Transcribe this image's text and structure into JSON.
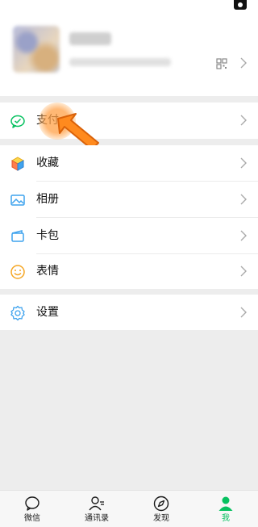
{
  "menu": {
    "pay_label": "支付",
    "favorites_label": "收藏",
    "album_label": "相册",
    "cards_label": "卡包",
    "stickers_label": "表情",
    "settings_label": "设置"
  },
  "tabbar": {
    "chats_label": "微信",
    "contacts_label": "通讯录",
    "discover_label": "发现",
    "me_label": "我"
  },
  "colors": {
    "accent": "#07c160",
    "background": "#ededed",
    "hint": "#ff8a1e"
  },
  "icons": {
    "pay": "wechat-pay-icon",
    "favorites": "cube-icon",
    "album": "image-icon",
    "cards": "wallet-icon",
    "stickers": "smiley-icon",
    "settings": "gear-icon"
  }
}
